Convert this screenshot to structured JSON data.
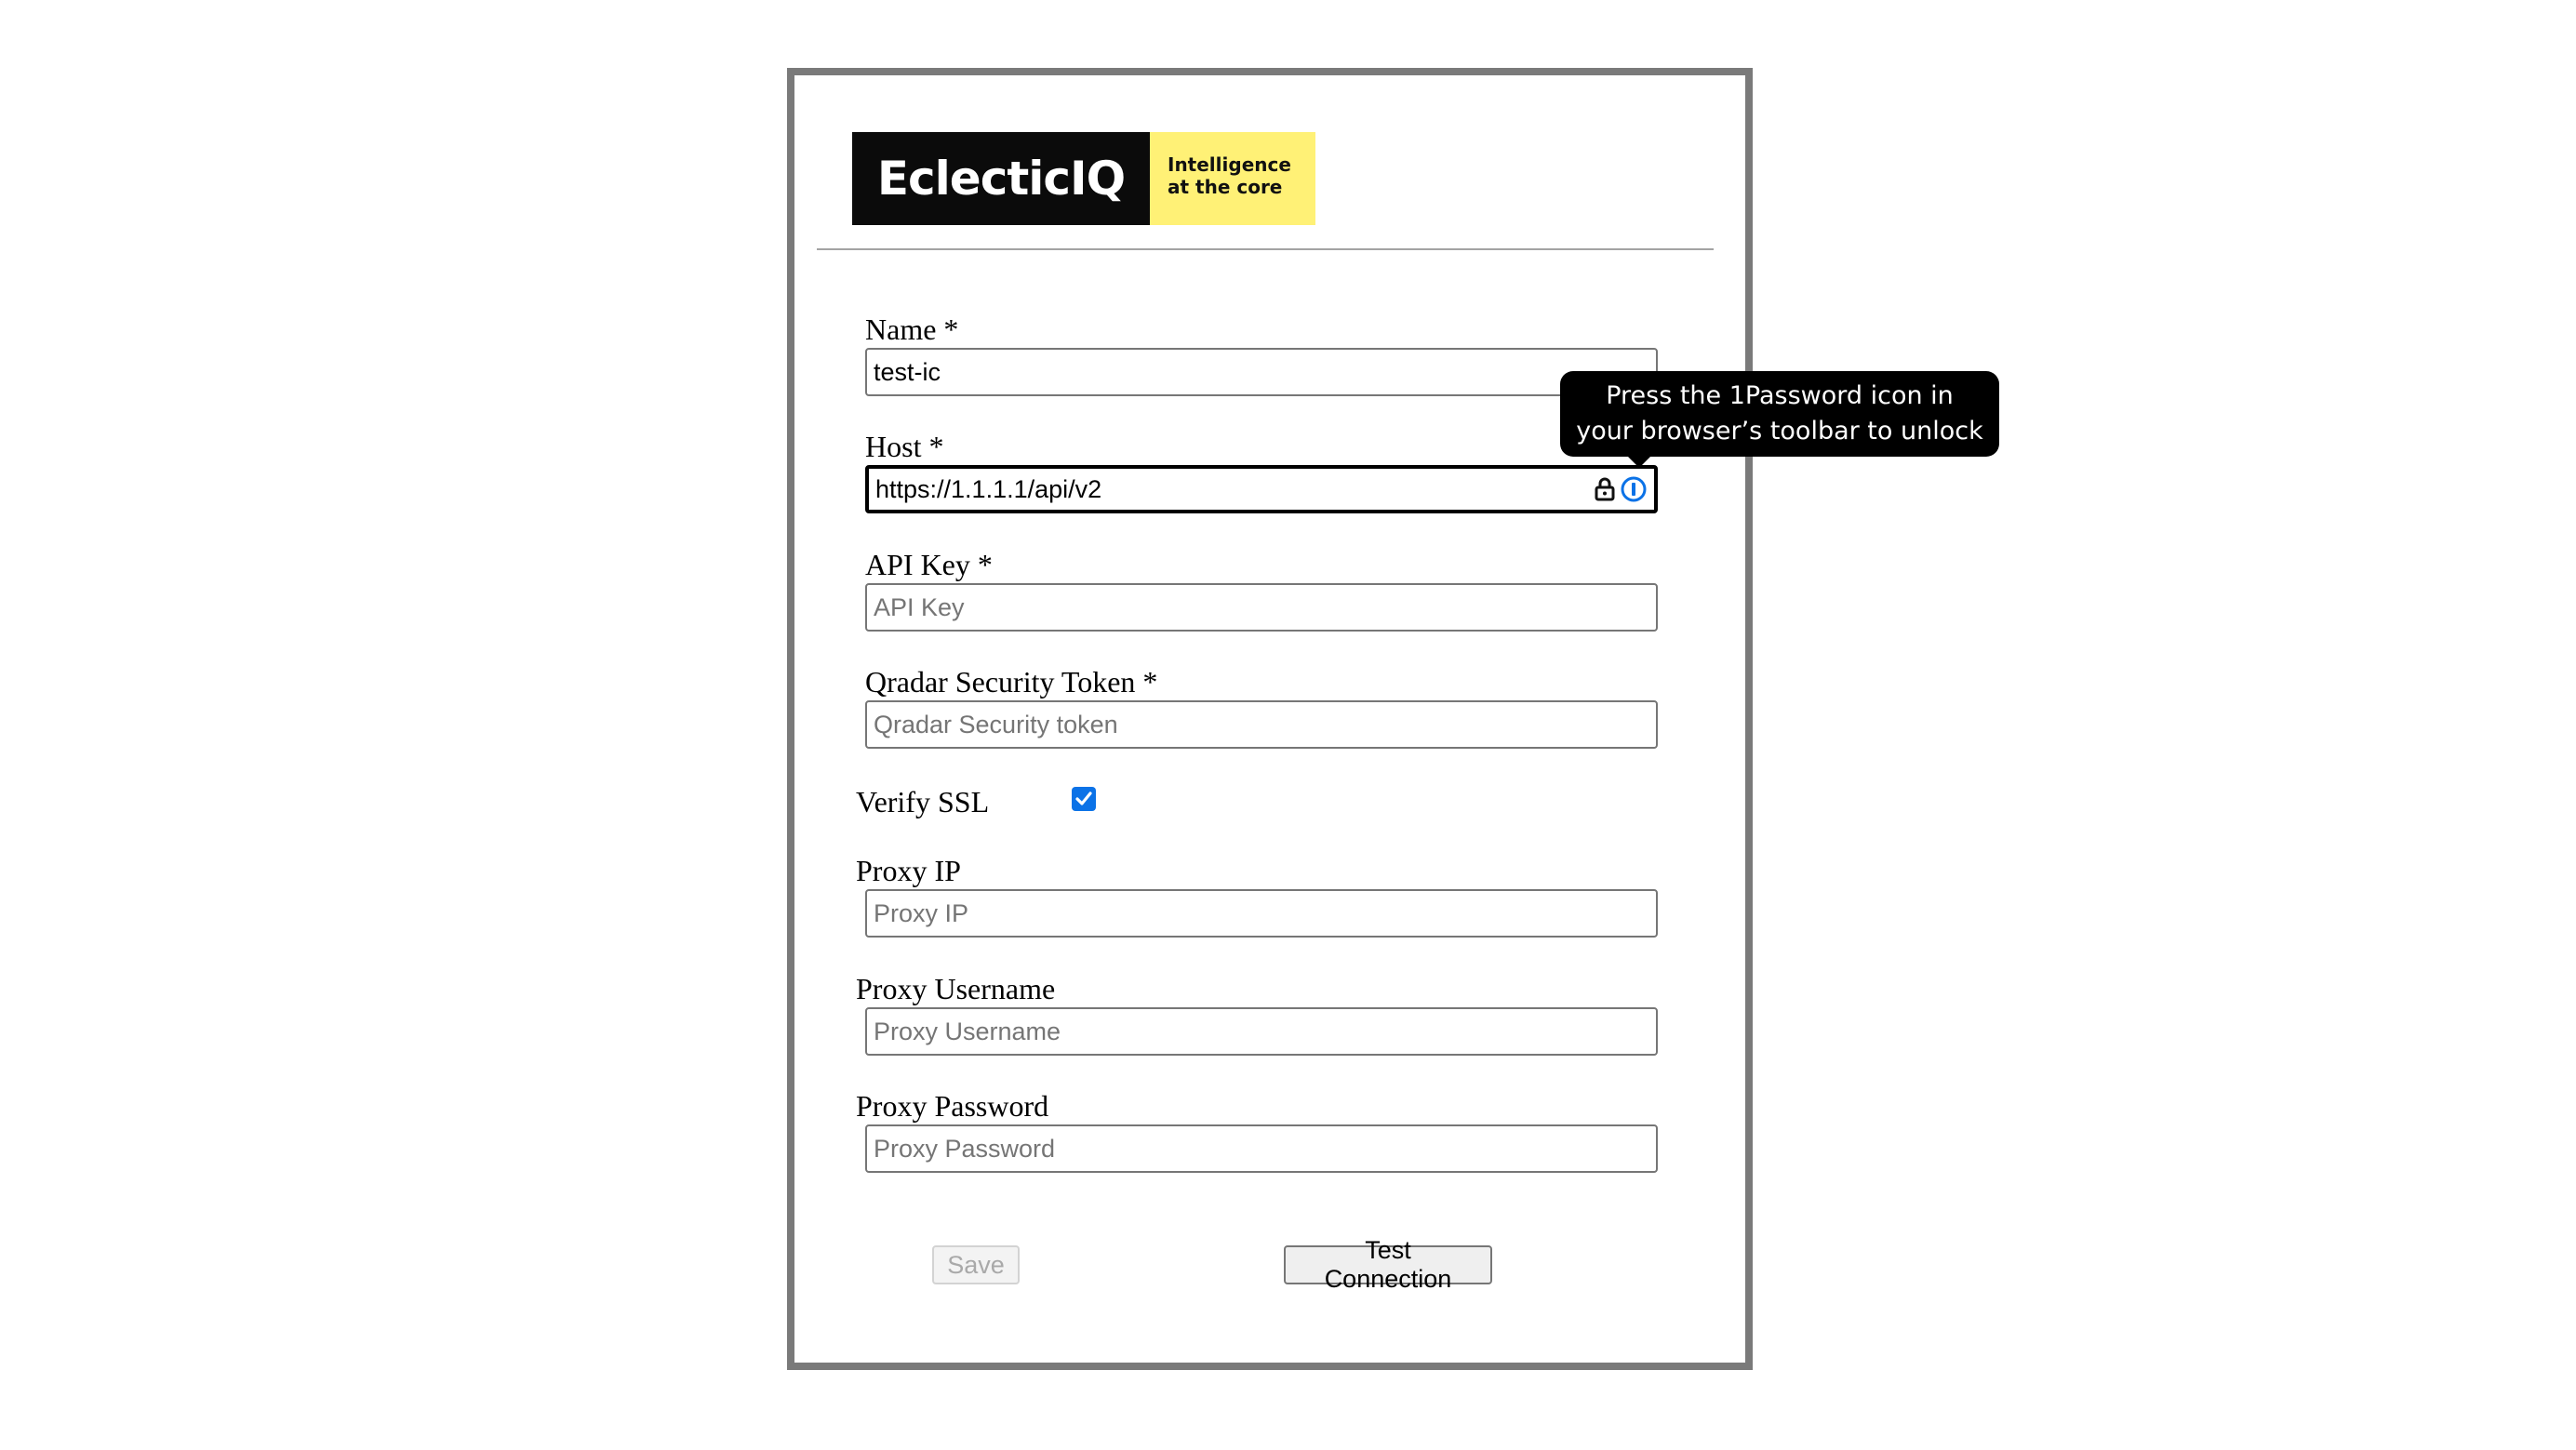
{
  "brand": {
    "logo_text": "EclecticIQ",
    "tagline_line1": "Intelligence",
    "tagline_line2": "at the core",
    "colors": {
      "dark": "#0b0b0b",
      "yellow": "#fff176"
    }
  },
  "form": {
    "name": {
      "label": "Name *",
      "value": "test-ic"
    },
    "host": {
      "label": "Host *",
      "value": "https://1.1.1.1/api/v2"
    },
    "api_key": {
      "label": "API Key *",
      "placeholder": "API Key"
    },
    "qradar_token": {
      "label": "Qradar Security Token *",
      "placeholder": "Qradar Security token"
    },
    "verify_ssl": {
      "label": "Verify SSL",
      "checked": true
    },
    "proxy_ip": {
      "label": "Proxy IP",
      "placeholder": "Proxy IP"
    },
    "proxy_username": {
      "label": "Proxy Username",
      "placeholder": "Proxy Username"
    },
    "proxy_password": {
      "label": "Proxy Password",
      "placeholder": "Proxy Password"
    }
  },
  "buttons": {
    "save": "Save",
    "test_connection": "Test Connection"
  },
  "password_manager": {
    "icons": [
      "lock-icon",
      "1password-icon"
    ],
    "tooltip_line1": "Press the 1Password icon in",
    "tooltip_line2": "your browser’s toolbar to unlock"
  },
  "colors": {
    "checkbox": "#0b72e7",
    "panel_border": "#7a7a7a"
  }
}
